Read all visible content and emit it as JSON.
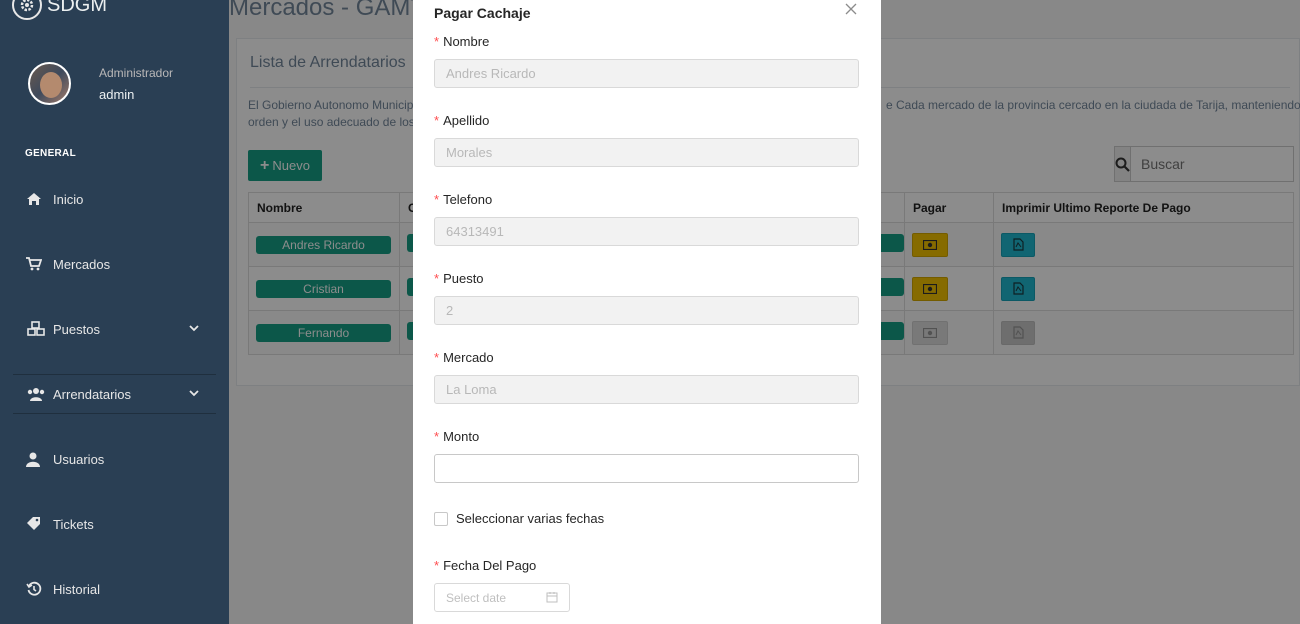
{
  "brand": {
    "title": "SDGM"
  },
  "profile": {
    "role": "Administrador",
    "name": "admin"
  },
  "menu": {
    "section": "GENERAL",
    "items": [
      {
        "label": "Inicio",
        "icon": "home-icon"
      },
      {
        "label": "Mercados",
        "icon": "cart-icon"
      },
      {
        "label": "Puestos",
        "icon": "cubes-icon",
        "chevron": true
      },
      {
        "label": "Arrendatarios",
        "icon": "users-icon",
        "chevron": true
      },
      {
        "label": "Usuarios",
        "icon": "user-icon"
      },
      {
        "label": "Tickets",
        "icon": "tag-icon"
      },
      {
        "label": "Historial",
        "icon": "history-icon"
      }
    ]
  },
  "page": {
    "title": "Mercados - GAMT",
    "panel_title": "Lista de Arrendatarios",
    "description_left": "El Gobierno Autonomo Municipa",
    "description_left_2": "orden y el uso adecuado de los p",
    "description_right": "e Cada mercado de la provincia cercado en la ciudada de Tarija, manteniendo el",
    "new_button": "Nuevo",
    "search_placeholder": "Buscar",
    "table": {
      "headers": [
        "Nombre",
        "C",
        "Pagar",
        "Imprimir Ultimo Reporte De Pago"
      ],
      "rows": [
        {
          "nombre": "Andres Ricardo"
        },
        {
          "nombre": "Cristian"
        },
        {
          "nombre": "Fernando"
        }
      ]
    }
  },
  "modal": {
    "title": "Pagar Cachaje",
    "fields": [
      {
        "label": "Nombre",
        "value": "Andres Ricardo"
      },
      {
        "label": "Apellido",
        "value": "Morales"
      },
      {
        "label": "Telefono",
        "value": "64313491"
      },
      {
        "label": "Puesto",
        "value": "2"
      },
      {
        "label": "Mercado",
        "value": "La Loma"
      },
      {
        "label": "Monto",
        "value": ""
      }
    ],
    "checkbox_label": "Seleccionar varias fechas",
    "date_label": "Fecha Del Pago",
    "date_placeholder": "Select date"
  },
  "colors": {
    "sidebar": "#2a3f54",
    "accent": "#169f85",
    "pay": "#f5c400",
    "print": "#20b8cf",
    "required": "#ff4d4f"
  }
}
